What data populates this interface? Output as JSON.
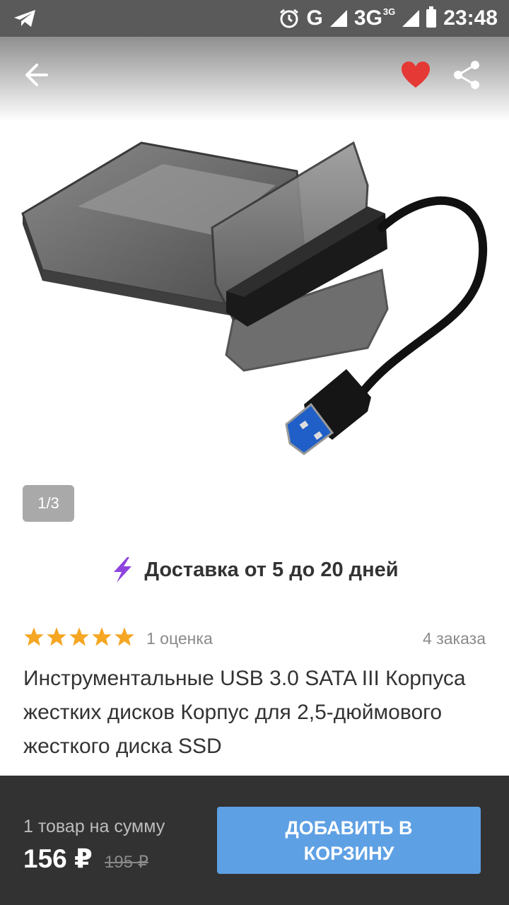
{
  "status_bar": {
    "network": "G",
    "network2": "3G",
    "network2_sup": "3G",
    "time": "23:48"
  },
  "header": {
    "icons": [
      "back-arrow-icon",
      "heart-icon",
      "share-icon"
    ],
    "favorite_color": "#e53935"
  },
  "gallery": {
    "counter": "1/3"
  },
  "delivery": {
    "text": "Доставка от 5 до 20 дней",
    "icon": "lightning-icon",
    "icon_color": "#8e44dd"
  },
  "product": {
    "rating_stars": 5,
    "rating_text": "1 оценка",
    "orders": "4 заказа",
    "title": "Инструментальные USB 3.0 SATA III Корпуса жестких дисков Корпус для 2,5-дюймового жесткого диска SSD",
    "star_color": "#f5a623"
  },
  "cart": {
    "sum_label": "1 товар на сумму",
    "price": "156 ₽",
    "old_price": "195 ₽",
    "add_button": "ДОБАВИТЬ В КОРЗИНУ",
    "accent": "#5ea0e4"
  }
}
